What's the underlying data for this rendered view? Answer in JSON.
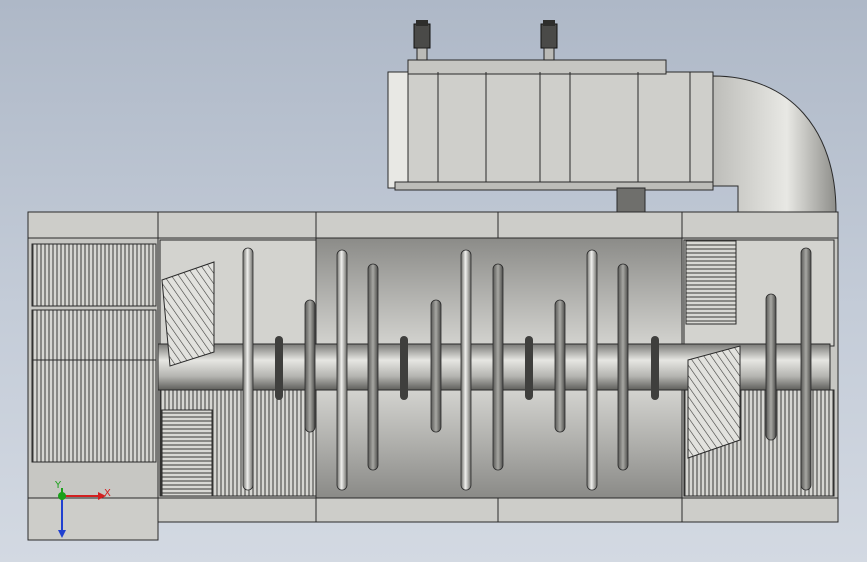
{
  "app": {
    "title": ""
  },
  "viewport": {
    "background_top": "#aeb8c7",
    "background_bottom": "#d3d9e2"
  },
  "triad": {
    "x_label": "X",
    "y_label": "Y",
    "x_color": "#d22020",
    "y_color": "#1aa01a",
    "z_color": "#2040d0"
  },
  "model": {
    "description_colors": {
      "body": "#c8c8c4",
      "edge": "#2a2a2a",
      "duct_dark": "#6f6f6c"
    }
  }
}
